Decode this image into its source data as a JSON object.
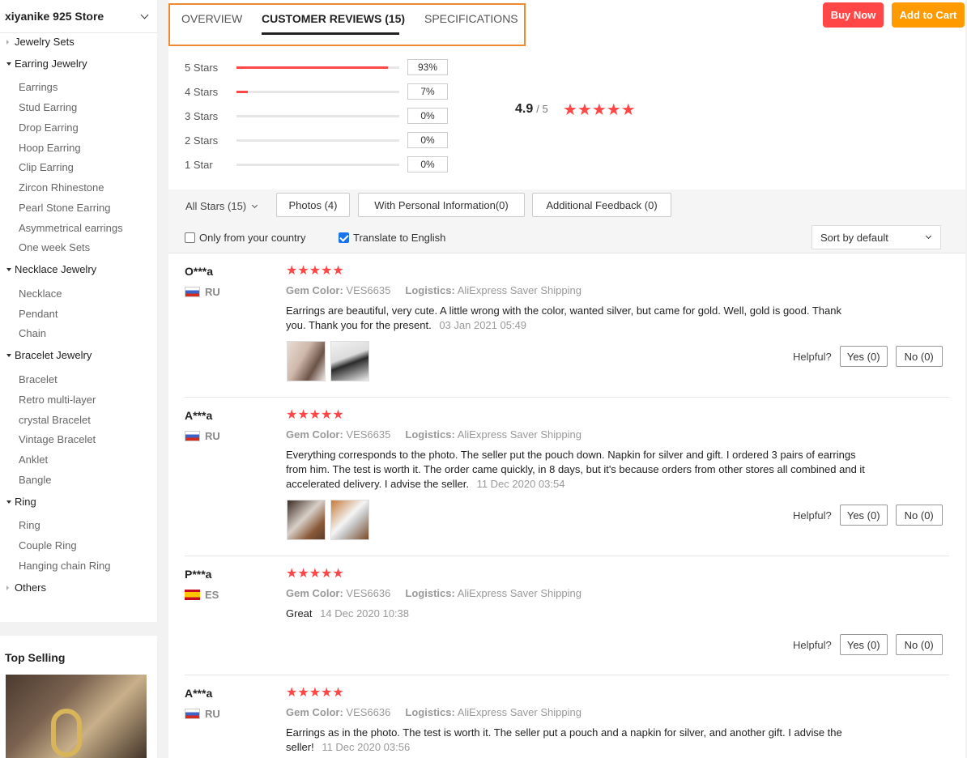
{
  "sidebar": {
    "store_name": "xiyanike 925 Store",
    "categories": [
      {
        "label": "Jewelry Sets",
        "expanded": false,
        "items": []
      },
      {
        "label": "Earring Jewelry",
        "expanded": true,
        "items": [
          "Earrings",
          "Stud Earring",
          "Drop Earring",
          "Hoop Earring",
          "Clip Earring",
          "Zircon Rhinestone",
          "Pearl Stone Earring",
          "Asymmetrical earrings",
          "One week Sets"
        ]
      },
      {
        "label": "Necklace Jewelry",
        "expanded": true,
        "items": [
          "Necklace",
          "Pendant",
          "Chain"
        ]
      },
      {
        "label": "Bracelet Jewelry",
        "expanded": true,
        "items": [
          "Bracelet",
          "Retro multi-layer",
          "crystal Bracelet",
          "Vintage Bracelet",
          "Anklet",
          "Bangle"
        ]
      },
      {
        "label": "Ring",
        "expanded": true,
        "items": [
          "Ring",
          "Couple Ring",
          "Hanging chain Ring"
        ]
      },
      {
        "label": "Others",
        "expanded": false,
        "items": []
      }
    ],
    "top_selling_title": "Top Selling"
  },
  "tabs": [
    {
      "label": "OVERVIEW",
      "active": false
    },
    {
      "label": "CUSTOMER REVIEWS (15)",
      "active": true
    },
    {
      "label": "SPECIFICATIONS",
      "active": false
    }
  ],
  "actions": {
    "buy_now": "Buy Now",
    "add_to_cart": "Add to Cart"
  },
  "rating_breakdown": [
    {
      "label": "5 Stars",
      "percent": 93,
      "percent_label": "93%"
    },
    {
      "label": "4 Stars",
      "percent": 7,
      "percent_label": "7%"
    },
    {
      "label": "3 Stars",
      "percent": 0,
      "percent_label": "0%"
    },
    {
      "label": "2 Stars",
      "percent": 0,
      "percent_label": "0%"
    },
    {
      "label": "1 Star",
      "percent": 0,
      "percent_label": "0%"
    }
  ],
  "average": {
    "score": "4.9",
    "out_of": "/ 5",
    "stars": 5
  },
  "filters": {
    "all_stars": "All Stars (15)",
    "photos": "Photos (4)",
    "personal_info": "With Personal Information(0)",
    "additional_feedback": "Additional Feedback (0)",
    "only_country": "Only from your country",
    "only_country_checked": false,
    "translate": "Translate to English",
    "translate_checked": true,
    "sort": "Sort by default"
  },
  "reviews": [
    {
      "user": "O***a",
      "country": "RU",
      "stars": 5,
      "gem_color_label": "Gem Color:",
      "gem_color": "VES6635",
      "logistics_label": "Logistics:",
      "logistics": "AliExpress Saver Shipping",
      "text": "Earrings are beautiful, very cute. A little wrong with the color, wanted silver, but came for gold. Well, gold is good. Thank you. Thank you for the present.",
      "date": "03 Jan 2021 05:49",
      "photos": 2,
      "helpful_label": "Helpful?",
      "yes": "Yes (0)",
      "no": "No (0)"
    },
    {
      "user": "A***a",
      "country": "RU",
      "stars": 5,
      "gem_color_label": "Gem Color:",
      "gem_color": "VES6635",
      "logistics_label": "Logistics:",
      "logistics": "AliExpress Saver Shipping",
      "text": "Everything corresponds to the photo. The seller put the pouch down. Napkin for silver and gift. I ordered 3 pairs of earrings from him. The test is worth it. The order came quickly, in 8 days, but it's because orders from other stores all combined and it accelerated delivery. I advise the seller.",
      "date": "11 Dec 2020 03:54",
      "photos": 2,
      "helpful_label": "Helpful?",
      "yes": "Yes (0)",
      "no": "No (0)"
    },
    {
      "user": "P***a",
      "country": "ES",
      "stars": 5,
      "gem_color_label": "Gem Color:",
      "gem_color": "VES6636",
      "logistics_label": "Logistics:",
      "logistics": "AliExpress Saver Shipping",
      "text": "Great",
      "date": "14 Dec 2020 10:38",
      "photos": 0,
      "helpful_label": "Helpful?",
      "yes": "Yes (0)",
      "no": "No (0)"
    },
    {
      "user": "A***a",
      "country": "RU",
      "stars": 5,
      "gem_color_label": "Gem Color:",
      "gem_color": "VES6636",
      "logistics_label": "Logistics:",
      "logistics": "AliExpress Saver Shipping",
      "text": "Earrings as in the photo. The test is worth it. The seller put a pouch and a napkin for silver, and another gift. I advise the seller!",
      "date": "11 Dec 2020 03:56",
      "photos": 0,
      "helpful_label": "Helpful?",
      "yes": "Yes (0)",
      "no": "No (0)"
    }
  ],
  "colors": {
    "accent_red": "#ff4747",
    "accent_orange": "#ff9a00",
    "tab_highlight": "#f08a32",
    "checkbox_blue": "#1a73e8"
  }
}
